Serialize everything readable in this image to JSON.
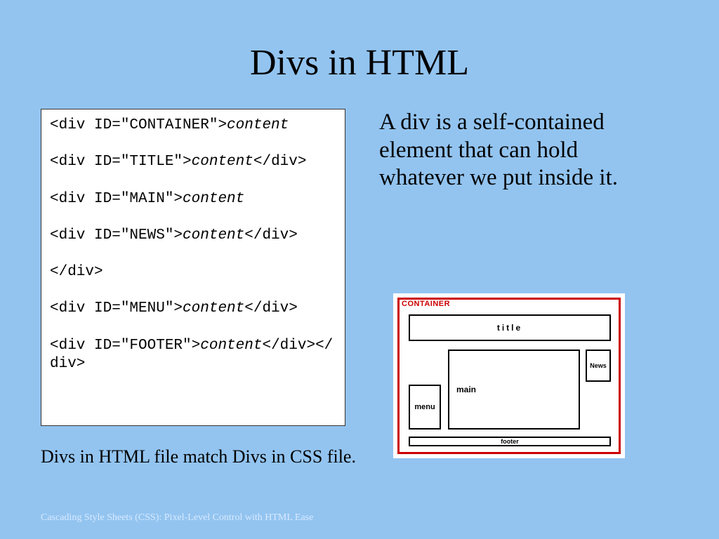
{
  "title": "Divs in HTML",
  "code": {
    "l1a": "<div ID=\"CONTAINER\">",
    "l1b": "content",
    "l2a": "<div ID=\"TITLE\">",
    "l2b": "content",
    "l2c": "</div>",
    "l3a": "<div ID=\"MAIN\">",
    "l3b": "content",
    "l4a": "<div ID=\"NEWS\">",
    "l4b": "content",
    "l4c": "</div>",
    "l5": "</div>",
    "l6a": "<div ID=\"MENU\">",
    "l6b": "content",
    "l6c": "</div>",
    "l7a": "<div ID=\"FOOTER\">",
    "l7b": "content",
    "l7c": "</div></div>"
  },
  "desc": "A div is a self-contained element that can hold whatever we put inside it.",
  "diagram": {
    "container": "CONTAINER",
    "title": "title",
    "menu": "menu",
    "main": "main",
    "news": "News",
    "footer": "footer"
  },
  "caption": "Divs in HTML file match Divs in CSS file.",
  "footer": "Cascading Style Sheets (CSS): Pixel-Level Control with HTML Ease"
}
